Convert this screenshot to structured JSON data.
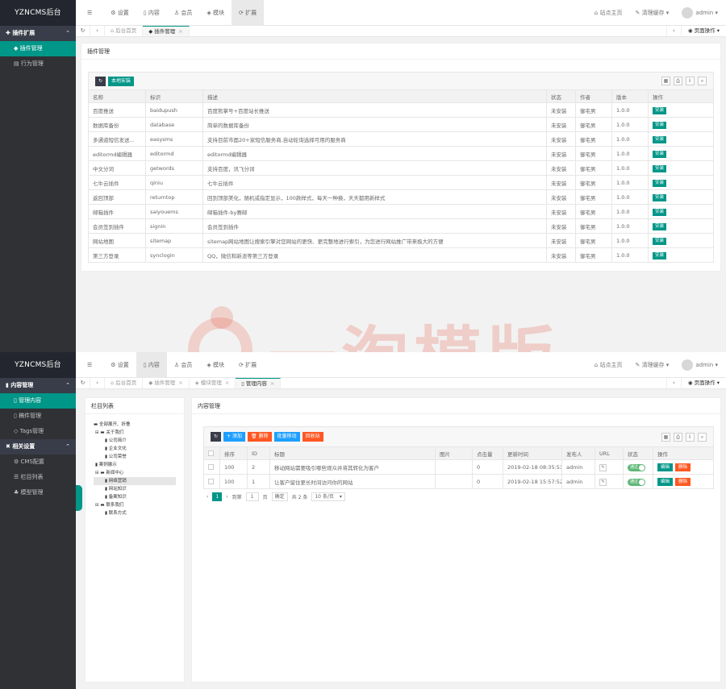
{
  "screen1": {
    "logo": "YZNCMS后台",
    "sidebar": {
      "group": "插件扩展",
      "items": [
        "插件管理",
        "行为管理"
      ]
    },
    "nav": [
      "设置",
      "内容",
      "会员",
      "模块",
      "扩展"
    ],
    "nav_right": {
      "site_home": "站点主页",
      "clear_cache": "清理缓存",
      "user": "admin"
    },
    "tabs": [
      "后台首页",
      "插件管理"
    ],
    "page_op": "页面操作",
    "card_title": "插件管理",
    "toolbar": {
      "local_install": "本地安装"
    },
    "columns": [
      "名称",
      "标识",
      "描述",
      "状态",
      "作者",
      "版本",
      "操作"
    ],
    "rows": [
      [
        "百度推送",
        "baidupush",
        "百度熊掌号+百度站长推送",
        "未安装",
        "御宅男",
        "1.0.0",
        "安装"
      ],
      [
        "数据库备份",
        "database",
        "简单的数据库备份",
        "未安装",
        "御宅男",
        "1.0.0",
        "安装"
      ],
      [
        "多通道短信发送...",
        "easysms",
        "支持目前市面20+家短信服务商,自动轮询选择可用的服务商",
        "未安装",
        "御宅男",
        "1.0.0",
        "安装"
      ],
      [
        "editormd编辑器",
        "editormd",
        "editormd编辑器",
        "未安装",
        "御宅男",
        "1.0.0",
        "安装"
      ],
      [
        "中文分词",
        "getwords",
        "支持百度，讯飞分词",
        "未安装",
        "御宅男",
        "1.0.0",
        "安装"
      ],
      [
        "七牛云插件",
        "qiniu",
        "七牛云插件",
        "未安装",
        "御宅男",
        "1.0.0",
        "安装"
      ],
      [
        "返回顶部",
        "returntop",
        "回到顶部美化，随机或指定显示，100款样式，每天一种换，天天都用新样式",
        "未安装",
        "御宅男",
        "1.0.0",
        "安装"
      ],
      [
        "邮箱插件",
        "saiyouems",
        "邮箱插件-by赛邮",
        "未安装",
        "御宅男",
        "1.0.0",
        "安装"
      ],
      [
        "会员签到插件",
        "signin",
        "会员签到插件",
        "未安装",
        "御宅男",
        "1.0.0",
        "安装"
      ],
      [
        "网站地图",
        "sitemap",
        "sitemap网站地图让搜索引擎对您网站的更快、更完整地进行索引，为您进行网站推广带来极大的方便",
        "未安装",
        "御宅男",
        "1.0.0",
        "安装"
      ],
      [
        "第三方登录",
        "synclogin",
        "QQ，微信和新浪等第三方登录",
        "未安装",
        "御宅男",
        "1.0.0",
        "安装"
      ]
    ]
  },
  "screen2": {
    "logo": "YZNCMS后台",
    "sidebar": {
      "group1": "内容管理",
      "items1": [
        "管理内容",
        "稿件管理",
        "Tags管理"
      ],
      "group2": "相关设置",
      "items2": [
        "CMS配置",
        "栏目列表",
        "模型管理"
      ]
    },
    "nav": [
      "设置",
      "内容",
      "会员",
      "模块",
      "扩展"
    ],
    "nav_right": {
      "site_home": "站点主页",
      "clear_cache": "清理缓存",
      "user": "admin"
    },
    "tabs": [
      "后台首页",
      "插件管理",
      "模块管理",
      "管理内容"
    ],
    "page_op": "页面操作",
    "tree_title": "栏目列表",
    "tree": [
      "全部展开、折叠",
      "关于我们",
      "公司简介",
      "企业文化",
      "公司荣誉",
      "案例展示",
      "新闻中心",
      "网络营销",
      "网站知识",
      "备案知识",
      "联系我们",
      "联系方式"
    ],
    "card_title": "内容管理",
    "toolbar": {
      "add": "添加",
      "delete": "删除",
      "batch_move": "批量移动",
      "recycle": "回收站"
    },
    "columns": [
      "",
      "排序",
      "ID",
      "标题",
      "图片",
      "点击量",
      "更新时间",
      "发布人",
      "URL",
      "状态",
      "操作"
    ],
    "rows": [
      {
        "sort": "100",
        "id": "2",
        "title": "移动网站需要吸引哪些观众并将其转化为客户",
        "img": "",
        "hits": "0",
        "time": "2019-02-18 08:35:53",
        "author": "admin",
        "status": "通过",
        "edit": "编辑",
        "del": "删除"
      },
      {
        "sort": "100",
        "id": "1",
        "title": "让客户留住更长时间访问你的网站",
        "img": "",
        "hits": "0",
        "time": "2019-02-18 15:57:52",
        "author": "admin",
        "status": "通过",
        "edit": "编辑",
        "del": "删除"
      }
    ],
    "pager": {
      "current": "1",
      "goto": "到第",
      "page_input": "1",
      "page_unit": "页",
      "confirm": "确定",
      "total": "共 2 条",
      "per_page": "10 条/页"
    }
  },
  "watermark": "一淘模版",
  "colors": {
    "accent": "#009688",
    "sidebar": "#2f3135",
    "danger": "#ff5722",
    "blue": "#1e9fff"
  }
}
